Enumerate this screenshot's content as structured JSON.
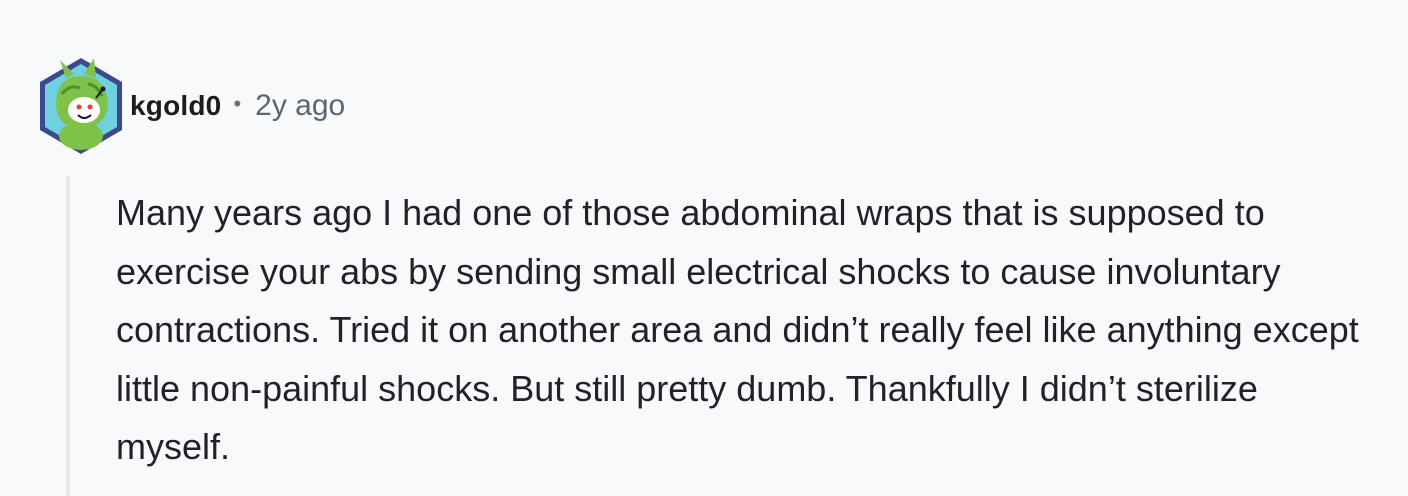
{
  "comment": {
    "username": "kgold0",
    "separator": "•",
    "timestamp": "2y ago",
    "avatar_icon": "reddit-snoo-avatar-icon",
    "text": "Many years ago I had one of those abdominal wraps that is supposed to exercise your abs by sending small electrical shocks to cause involuntary contractions. Tried it on another area and didn’t really feel like anything except little non-painful shocks. But still pretty dumb. Thankfully I didn’t sterilize myself."
  },
  "colors": {
    "background": "#f8f9fa",
    "avatar_hex_outer": "#3a4a8c",
    "avatar_hex_inner": "#6fd0e0",
    "avatar_character": "#7fc24a",
    "text": "#1f2329",
    "muted": "#5b6670",
    "thread_line": "#e4e8eb"
  }
}
